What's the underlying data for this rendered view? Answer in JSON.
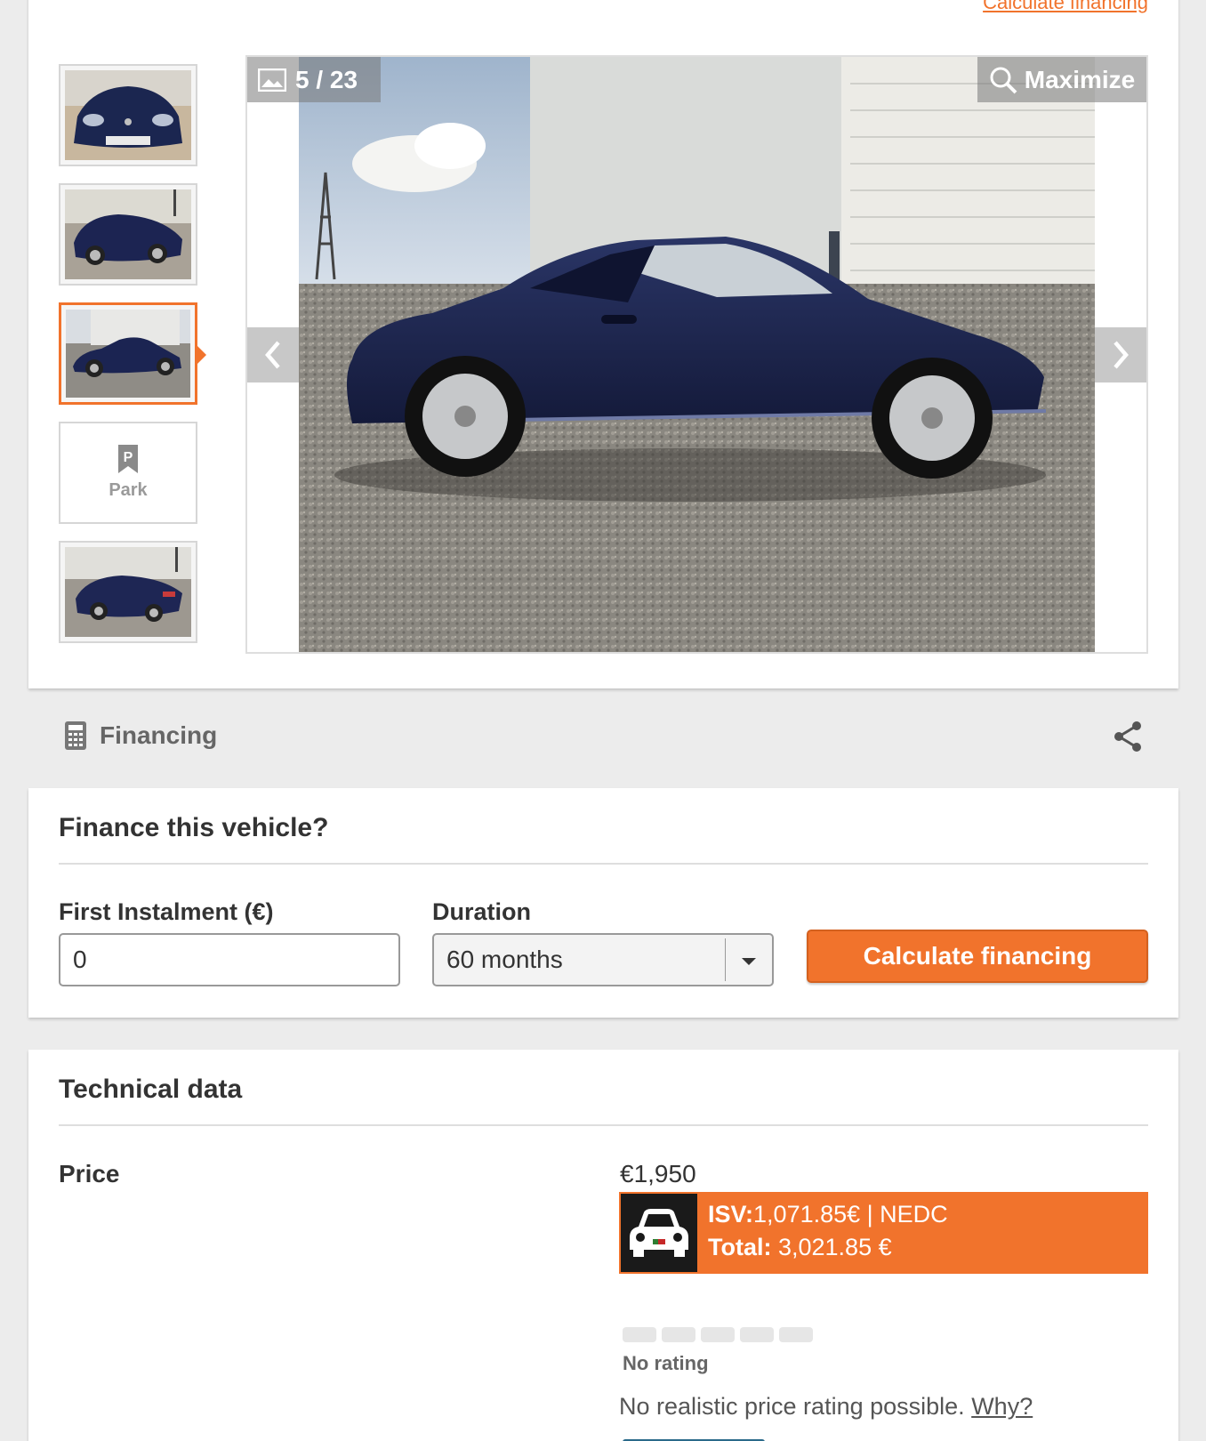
{
  "gallery": {
    "top_link": "Calculate financing",
    "counter": "5 / 23",
    "maximize_label": "Maximize",
    "thumbnails": [
      {
        "kind": "photo"
      },
      {
        "kind": "photo"
      },
      {
        "kind": "photo",
        "active": true
      },
      {
        "kind": "park",
        "label": "Park"
      },
      {
        "kind": "photo"
      }
    ],
    "park_label": "Park"
  },
  "financing_bar": {
    "label": "Financing",
    "icon": "calculator-icon",
    "share_icon": "share-icon"
  },
  "finance_form": {
    "title": "Finance this vehicle?",
    "first_instalment_label": "First Instalment (€)",
    "first_instalment_value": "0",
    "duration_label": "Duration",
    "duration_value": "60 months",
    "submit_label": "Calculate financing"
  },
  "technical": {
    "title": "Technical data",
    "price_label": "Price",
    "price_value": "€1,950",
    "isv_label": "ISV:",
    "isv_value": "1,071.85€ | NEDC",
    "total_label": "Total:",
    "total_value": " 3,021.85 €",
    "rating_text": "No rating",
    "rating_note": "No realistic price rating possible.",
    "why_link": "Why?"
  },
  "colors": {
    "accent": "#f1732c",
    "background": "#ececec"
  }
}
